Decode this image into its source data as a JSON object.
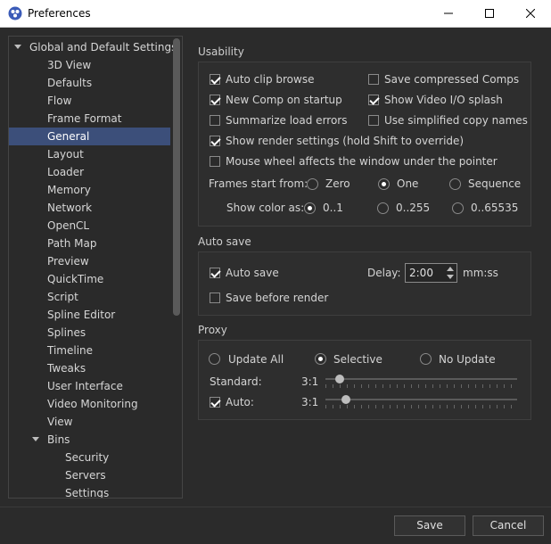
{
  "window": {
    "title": "Preferences"
  },
  "tree": {
    "items": [
      {
        "label": "Global and Default Settings",
        "level": 0,
        "expanded": true
      },
      {
        "label": "3D View",
        "level": 1
      },
      {
        "label": "Defaults",
        "level": 1
      },
      {
        "label": "Flow",
        "level": 1
      },
      {
        "label": "Frame Format",
        "level": 1
      },
      {
        "label": "General",
        "level": 1,
        "selected": true
      },
      {
        "label": "Layout",
        "level": 1
      },
      {
        "label": "Loader",
        "level": 1
      },
      {
        "label": "Memory",
        "level": 1
      },
      {
        "label": "Network",
        "level": 1
      },
      {
        "label": "OpenCL",
        "level": 1
      },
      {
        "label": "Path Map",
        "level": 1
      },
      {
        "label": "Preview",
        "level": 1
      },
      {
        "label": "QuickTime",
        "level": 1
      },
      {
        "label": "Script",
        "level": 1
      },
      {
        "label": "Spline Editor",
        "level": 1
      },
      {
        "label": "Splines",
        "level": 1
      },
      {
        "label": "Timeline",
        "level": 1
      },
      {
        "label": "Tweaks",
        "level": 1
      },
      {
        "label": "User Interface",
        "level": 1
      },
      {
        "label": "Video Monitoring",
        "level": 1
      },
      {
        "label": "View",
        "level": 1
      },
      {
        "label": "Bins",
        "level": 1,
        "expanded": true
      },
      {
        "label": "Security",
        "level": 2
      },
      {
        "label": "Servers",
        "level": 2
      },
      {
        "label": "Settings",
        "level": 2
      }
    ]
  },
  "usability": {
    "title": "Usability",
    "auto_clip_browse": "Auto clip browse",
    "save_compressed_comps": "Save compressed Comps",
    "new_comp_on_startup": "New Comp on startup",
    "show_video_io_splash": "Show Video I/O splash",
    "summarize_load_errors": "Summarize load errors",
    "use_simplified_copy_names": "Use simplified copy names",
    "show_render_settings": "Show render settings (hold Shift to override)",
    "mouse_wheel": "Mouse wheel affects the window under the pointer",
    "frames_start_from": "Frames start from:",
    "frames_options": [
      "Zero",
      "One",
      "Sequence"
    ],
    "frames_selected": "One",
    "show_color_as": "Show color as:",
    "color_options": [
      "0..1",
      "0..255",
      "0..65535"
    ],
    "color_selected": "0..1"
  },
  "autosave": {
    "title": "Auto save",
    "auto_save": "Auto save",
    "delay_label": "Delay:",
    "delay_value": "2:00",
    "delay_unit": "mm:ss",
    "save_before_render": "Save before render"
  },
  "proxy": {
    "title": "Proxy",
    "options": [
      "Update All",
      "Selective",
      "No Update"
    ],
    "selected": "Selective",
    "standard_label": "Standard:",
    "standard_value": "3:1",
    "auto_label": "Auto:",
    "auto_value": "3:1"
  },
  "buttons": {
    "save": "Save",
    "cancel": "Cancel"
  }
}
